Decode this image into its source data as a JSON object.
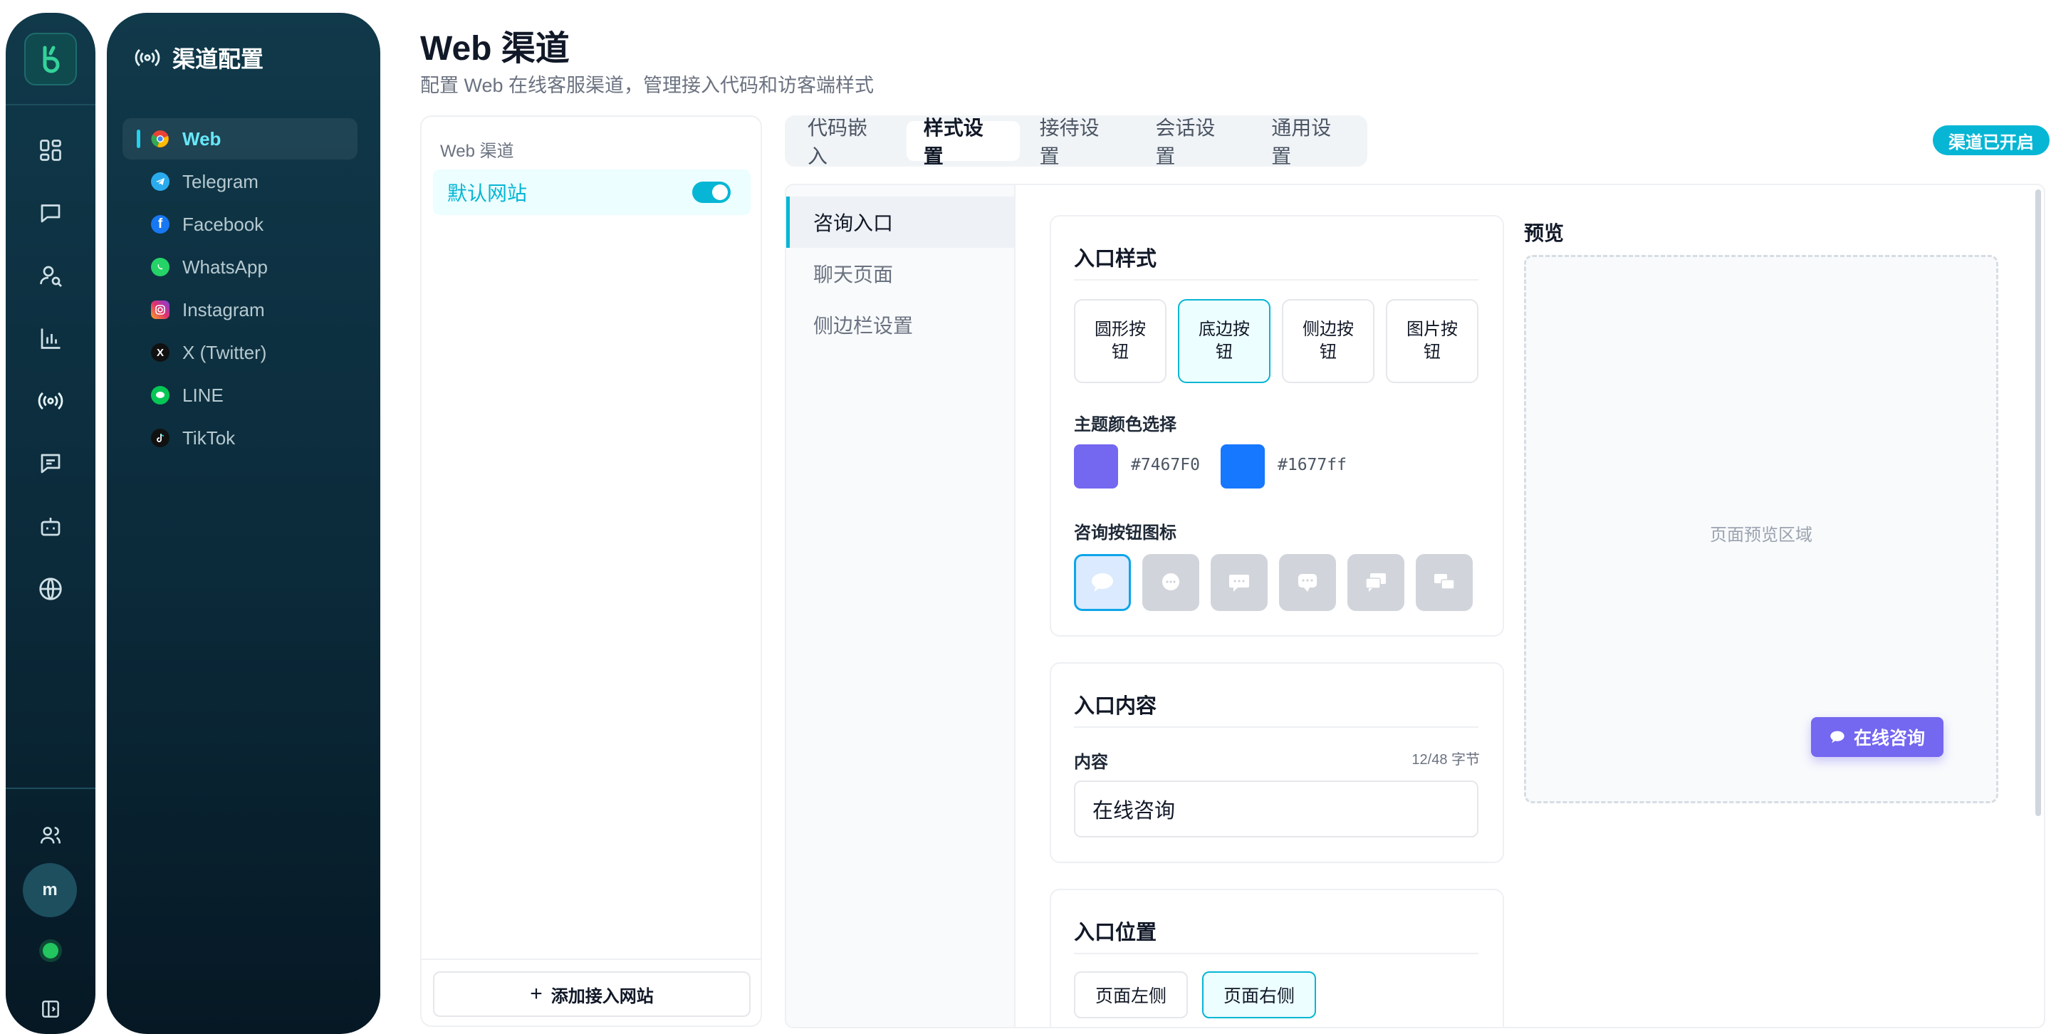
{
  "rail": {
    "icons": [
      "dashboard-icon",
      "chat-icon",
      "contacts-search-icon",
      "analytics-icon",
      "channels-icon",
      "messages-icon",
      "bot-icon",
      "globe-icon"
    ],
    "bottom_icons": [
      "team-icon",
      "collapse-sidebar-icon"
    ],
    "avatar_initial": "m",
    "status_color": "#22c55e"
  },
  "nav": {
    "title": "渠道配置",
    "items": [
      {
        "label": "Web",
        "color": "#ea4335",
        "icon": "chrome-icon"
      },
      {
        "label": "Telegram",
        "color": "#2aabee",
        "icon": "telegram-icon"
      },
      {
        "label": "Facebook",
        "color": "#1877f2",
        "icon": "facebook-icon"
      },
      {
        "label": "WhatsApp",
        "color": "#25d366",
        "icon": "whatsapp-icon"
      },
      {
        "label": "Instagram",
        "color": "#e1306c",
        "icon": "instagram-icon"
      },
      {
        "label": "X (Twitter)",
        "color": "#111111",
        "icon": "x-icon"
      },
      {
        "label": "LINE",
        "color": "#06c755",
        "icon": "line-icon"
      },
      {
        "label": "TikTok",
        "color": "#111111",
        "icon": "tiktok-icon"
      }
    ]
  },
  "header": {
    "title": "Web 渠道",
    "subtitle": "配置 Web 在线客服渠道，管理接入代码和访客端样式"
  },
  "sites": {
    "heading": "Web 渠道",
    "items": [
      {
        "name": "默认网站",
        "enabled": true
      }
    ],
    "add_label": "添加接入网站"
  },
  "tabs": {
    "items": [
      "代码嵌入",
      "样式设置",
      "接待设置",
      "会话设置",
      "通用设置"
    ],
    "active": "样式设置"
  },
  "status_badge": "渠道已开启",
  "subnav": {
    "items": [
      "咨询入口",
      "聊天页面",
      "侧边栏设置"
    ],
    "active": "咨询入口"
  },
  "entry_style": {
    "title": "入口样式",
    "options": [
      "圆形按钮",
      "底边按钮",
      "侧边按钮",
      "图片按钮"
    ],
    "selected": "底边按钮",
    "theme_label": "主题颜色选择",
    "colors": [
      {
        "hex": "#7467F0",
        "value": "#7467f0"
      },
      {
        "hex": "#1677ff",
        "value": "#1677ff"
      }
    ],
    "icon_label": "咨询按钮图标",
    "icons": [
      "speech-bubble-icon",
      "round-bubble-icon",
      "dots-bubble-icon",
      "square-bubble-icon",
      "double-bubble-icon",
      "multi-bubble-icon"
    ],
    "selected_icon": 0
  },
  "entry_content": {
    "title": "入口内容",
    "field_label": "内容",
    "count": "12/48 字节",
    "value": "在线咨询"
  },
  "entry_position": {
    "title": "入口位置",
    "options": [
      "页面左侧",
      "页面右侧"
    ],
    "selected": "页面右侧"
  },
  "preview": {
    "title": "预览",
    "placeholder": "页面预览区域",
    "button_label": "在线咨询",
    "button_color": "#7467f0"
  }
}
